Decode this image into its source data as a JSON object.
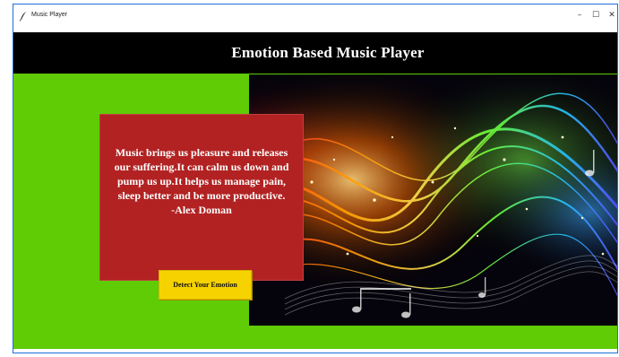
{
  "window": {
    "title": "Music Player",
    "icon": "feather-icon",
    "controls": {
      "minimize": "–",
      "maximize": "☐",
      "close": "✕"
    }
  },
  "header": {
    "title": "Emotion Based Music Player",
    "background": "#000000",
    "text_color": "#ffffff"
  },
  "main": {
    "background": "#5fcc05",
    "quote_card": {
      "background": "#b22222",
      "lines": [
        "Music brings us pleasure and releases",
        "our suffering.It can calm us down and",
        "pump us up.It helps us manage pain,",
        "sleep better and be more productive.",
        "-Alex Doman"
      ]
    },
    "detect_button": {
      "label": "Detect Your Emotion",
      "background": "#f6d200"
    },
    "artwork": {
      "icon": "music-waves-artwork"
    }
  }
}
